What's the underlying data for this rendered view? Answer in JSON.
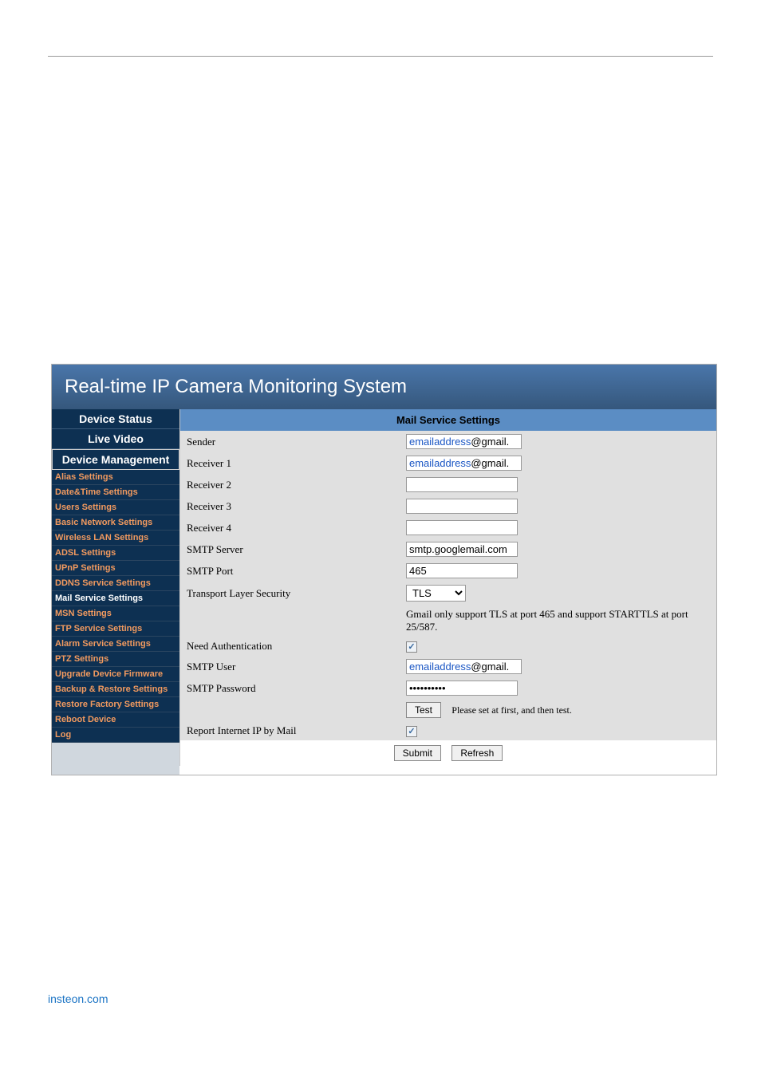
{
  "header": {
    "title": "Real-time IP Camera Monitoring System"
  },
  "sidebar": {
    "sections": {
      "status": "Device Status",
      "live": "Live Video",
      "mgmt": "Device Management"
    },
    "items": [
      "Alias Settings",
      "Date&Time Settings",
      "Users Settings",
      "Basic Network Settings",
      "Wireless LAN Settings",
      "ADSL Settings",
      "UPnP Settings",
      "DDNS Service Settings",
      "Mail Service Settings",
      "MSN Settings",
      "FTP Service Settings",
      "Alarm Service Settings",
      "PTZ Settings",
      "Upgrade Device Firmware",
      "Backup & Restore Settings",
      "Restore Factory Settings",
      "Reboot Device",
      "Log"
    ]
  },
  "panel": {
    "title": "Mail Service Settings",
    "labels": {
      "sender": "Sender",
      "r1": "Receiver 1",
      "r2": "Receiver 2",
      "r3": "Receiver 3",
      "r4": "Receiver 4",
      "smtp_server": "SMTP Server",
      "smtp_port": "SMTP Port",
      "tls": "Transport Layer Security",
      "need_auth": "Need Authentication",
      "smtp_user": "SMTP User",
      "smtp_pass": "SMTP Password",
      "report": "Report Internet IP by Mail"
    },
    "values": {
      "sender_blue": "emailaddress",
      "sender_black": "@gmail.",
      "r1_blue": "emailaddress",
      "r1_black": "@gmail.",
      "r2": "",
      "r3": "",
      "r4": "",
      "smtp_server": "smtp.googlemail.com",
      "smtp_port": "465",
      "tls": "TLS",
      "smtp_user_blue": "emailaddress",
      "smtp_user_black": "@gmail.",
      "smtp_pass": "••••••••••"
    },
    "note": "Gmail only support TLS at port 465 and support STARTTLS at port 25/587.",
    "test_btn": "Test",
    "test_hint": "Please set at first, and then test.",
    "submit": "Submit",
    "refresh": "Refresh",
    "check": "✓"
  },
  "footer": {
    "link": "insteon.com"
  }
}
